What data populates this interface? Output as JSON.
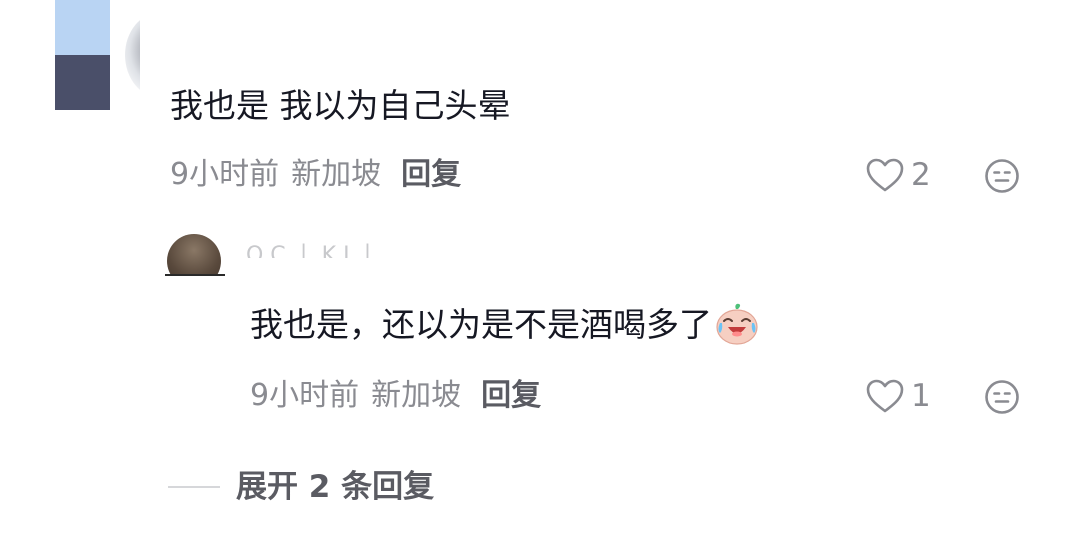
{
  "comment": {
    "text": "我也是 我以为自己头晕",
    "time": "9小时前",
    "region": "新加坡",
    "reply_label": "回复",
    "like_count": "2",
    "icons": {
      "like": "heart-outline-icon",
      "dislike": "expressionless-face-icon"
    }
  },
  "reply": {
    "username": "O C 丨 K I 丨 . .",
    "text": "我也是，还以为是不是酒喝多了",
    "emoji": "crying-laughing-emoji",
    "time": "9小时前",
    "region": "新加坡",
    "reply_label": "回复",
    "like_count": "1"
  },
  "expand": {
    "label": "展开 2 条回复"
  },
  "colors": {
    "primary_text": "#161823",
    "secondary_text": "#8a8b91",
    "action_text": "#5a5b62",
    "divider": "#d6d7da"
  }
}
